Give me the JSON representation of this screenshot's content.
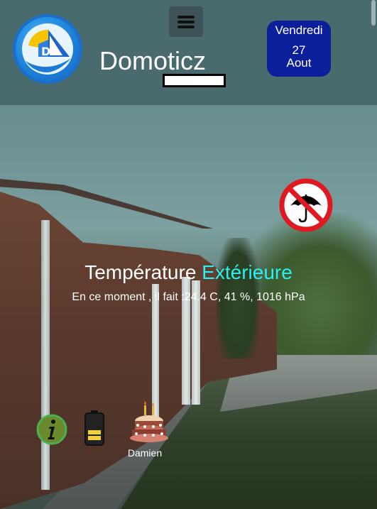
{
  "header": {
    "app_title": "Domoticz",
    "menu_icon": "hamburger-menu-icon",
    "logo_icon": "domoticz-logo-icon",
    "date": {
      "weekday": "Vendredi",
      "day": "27",
      "month": "Aout"
    }
  },
  "weather": {
    "alert_icon": "no-umbrella-icon",
    "title_main": "Température",
    "title_accent": "Extérieure",
    "detail": "En ce moment , il fait :24.4 C, 41 %, 1016 hPa"
  },
  "status_icons": [
    {
      "name": "info-icon"
    },
    {
      "name": "battery-icon",
      "level": 0.5
    },
    {
      "name": "birthday-cake-icon",
      "label": "Damien"
    }
  ],
  "colors": {
    "header_bg": "#48686a",
    "date_box": "#0b1f9a",
    "accent_text": "#2af0f0",
    "alert_red": "#e01822",
    "battery_yellow": "#f3d03a",
    "info_green": "#4caf50"
  }
}
